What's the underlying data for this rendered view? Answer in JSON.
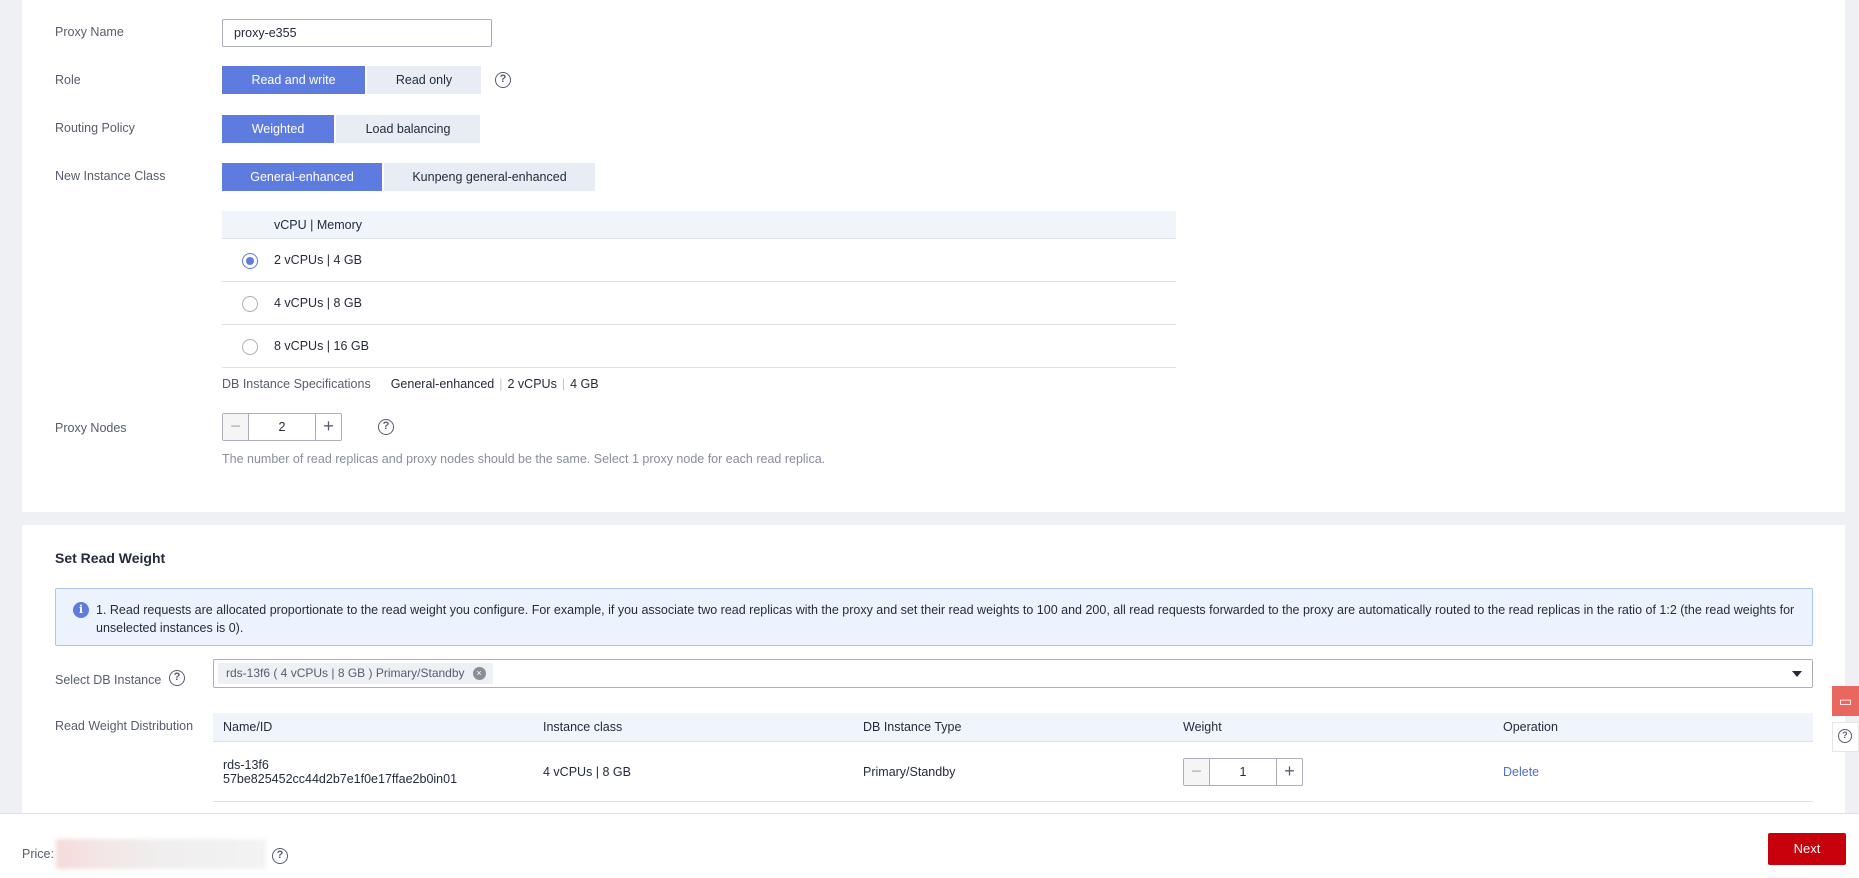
{
  "form": {
    "proxy_name_label": "Proxy Name",
    "proxy_name_value": "proxy-e355",
    "role_label": "Role",
    "role_options": [
      "Read and write",
      "Read only"
    ],
    "routing_label": "Routing Policy",
    "routing_options": [
      "Weighted",
      "Load balancing"
    ],
    "instance_class_label": "New Instance Class",
    "instance_class_options": [
      "General-enhanced",
      "Kunpeng general-enhanced"
    ],
    "spec_header": "vCPU | Memory",
    "spec_rows": [
      "2 vCPUs | 4 GB",
      "4 vCPUs | 8 GB",
      "8 vCPUs | 16 GB"
    ],
    "spec_summary_label": "DB Instance Specifications",
    "spec_summary_values": [
      "General-enhanced",
      "2 vCPUs",
      "4 GB"
    ],
    "proxy_nodes_label": "Proxy Nodes",
    "proxy_nodes_value": "2",
    "proxy_nodes_note": "The number of read replicas and proxy nodes should be the same. Select 1 proxy node for each read replica."
  },
  "read_weight": {
    "title": "Set Read Weight",
    "info": "1. Read requests are allocated proportionate to the read weight you configure. For example, if you associate two read replicas with the proxy and set their read weights to 100 and 200, all read requests forwarded to the proxy are automatically routed to the read replicas in the ratio of 1:2 (the read weights for unselected instances is 0).",
    "select_label": "Select DB Instance",
    "selected_tag": "rds-13f6 ( 4 vCPUs | 8 GB )  Primary/Standby",
    "distribution_label": "Read Weight Distribution",
    "columns": [
      "Name/ID",
      "Instance class",
      "DB Instance Type",
      "Weight",
      "Operation"
    ],
    "rows": [
      {
        "name": "rds-13f6",
        "id": "57be825452cc44d2b7e1f0e17ffae2b0in01",
        "instance_class": "4 vCPUs | 8 GB",
        "type": "Primary/Standby",
        "weight": "1",
        "operation": "Delete"
      }
    ]
  },
  "footer": {
    "price_label": "Price:",
    "next_label": "Next"
  },
  "icons": {
    "help": "?",
    "info": "i",
    "minus": "−",
    "plus": "+",
    "close": "×",
    "chat": "▭"
  },
  "colors": {
    "primary": "#5e7ce0",
    "next_button": "#c7000b",
    "link": "#526ecc"
  }
}
